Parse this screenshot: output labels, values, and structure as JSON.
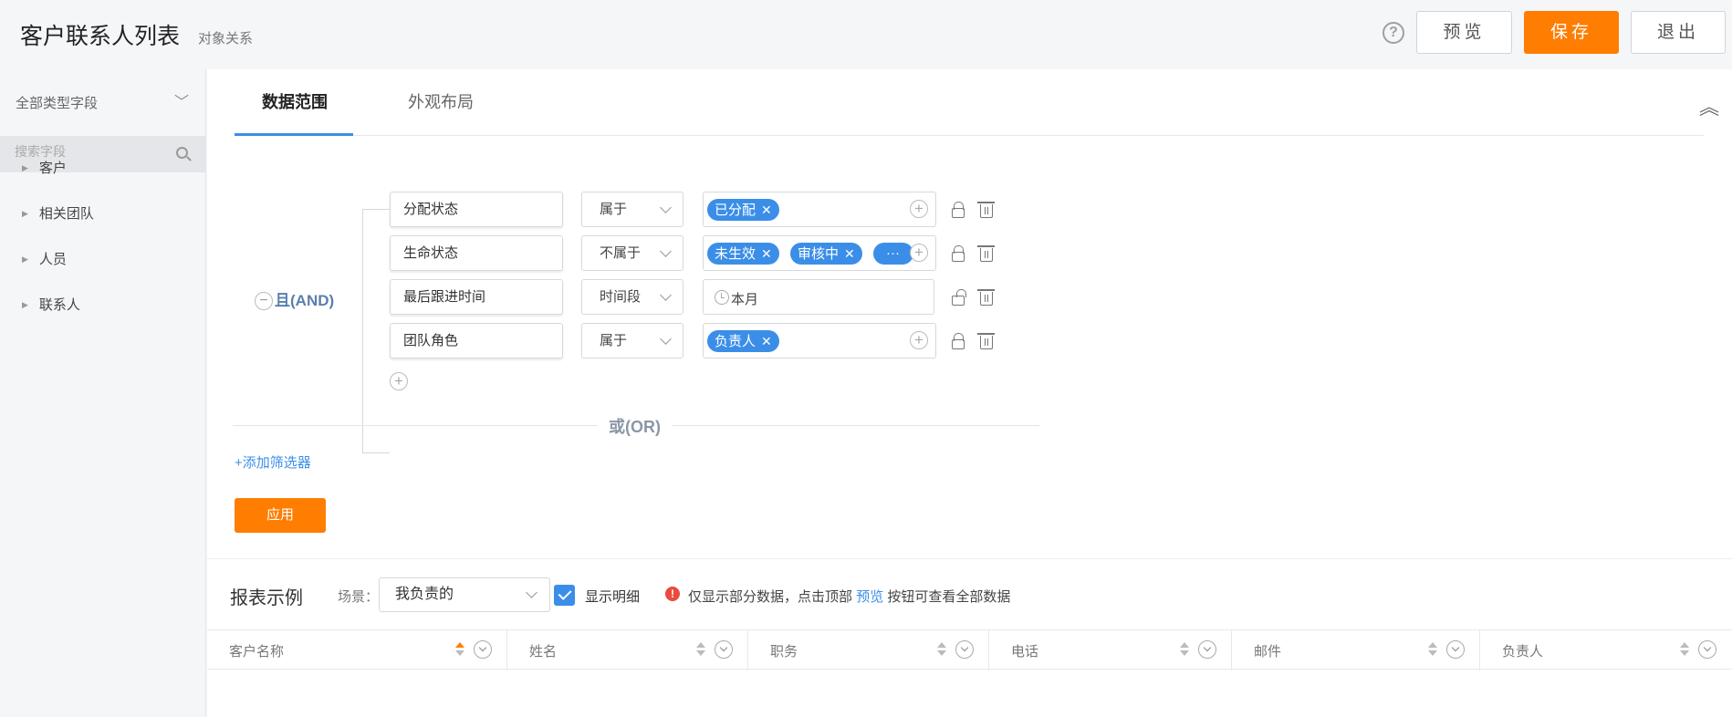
{
  "header": {
    "title": "客户联系人列表",
    "subtitle": "对象关系",
    "help": "?",
    "preview_label": "预览",
    "save_label": "保存",
    "exit_label": "退出"
  },
  "sidebar": {
    "type_select": "全部类型字段",
    "search_placeholder": "搜索字段",
    "items": [
      {
        "label": "客户"
      },
      {
        "label": "相关团队"
      },
      {
        "label": "人员"
      },
      {
        "label": "联系人"
      }
    ]
  },
  "tabs": [
    {
      "label": "数据范围",
      "active": true
    },
    {
      "label": "外观布局",
      "active": false
    }
  ],
  "filter": {
    "and_label": "且(AND)",
    "or_label": "或(OR)",
    "add_filter": "+添加筛选器",
    "apply": "应用",
    "conditions": [
      {
        "field": "分配状态",
        "operator": "属于",
        "tags": [
          "已分配"
        ],
        "value_text": "",
        "locked": true
      },
      {
        "field": "生命状态",
        "operator": "不属于",
        "tags": [
          "未生效",
          "审核中",
          "···"
        ],
        "value_text": "",
        "locked": true
      },
      {
        "field": "最后跟进时间",
        "operator": "时间段",
        "tags": [],
        "value_text": "本月",
        "locked": false
      },
      {
        "field": "团队角色",
        "operator": "属于",
        "tags": [
          "负责人"
        ],
        "value_text": "",
        "locked": true
      }
    ]
  },
  "report": {
    "title": "报表示例",
    "scene_label": "场景：",
    "scene_value": "我负责的",
    "show_detail": "显示明细",
    "show_detail_checked": true,
    "notice_prefix": "仅显示部分数据，点击顶部",
    "notice_link": "预览",
    "notice_suffix": "按钮可查看全部数据",
    "columns": [
      "客户名称",
      "姓名",
      "职务",
      "电话",
      "邮件",
      "负责人"
    ]
  },
  "colors": {
    "accent": "#ff7d00",
    "primary": "#3b8ee8",
    "warning": "#e94b3c"
  }
}
